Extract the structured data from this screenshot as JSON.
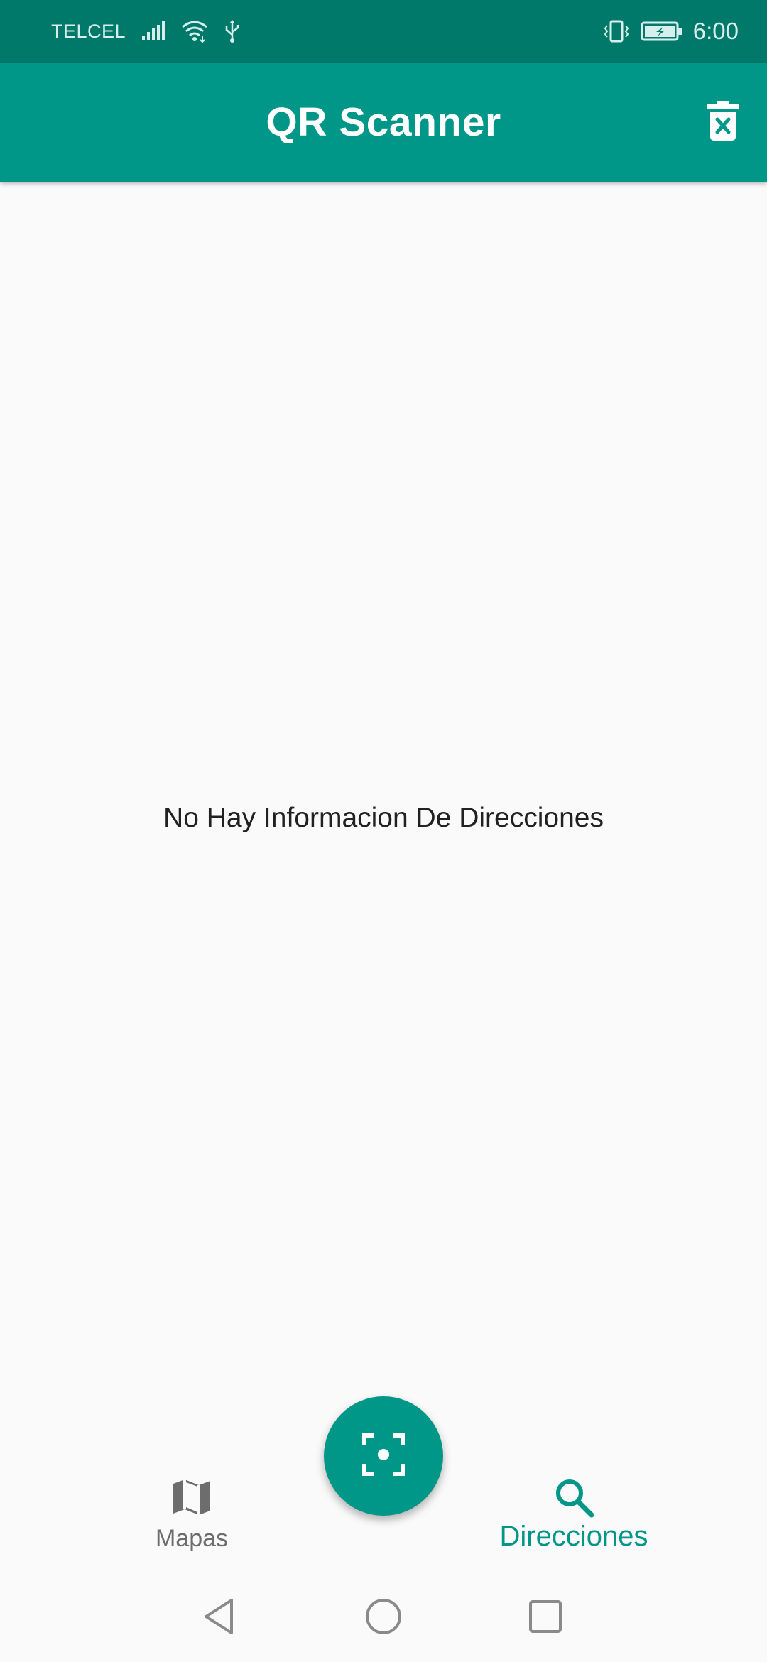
{
  "status_bar": {
    "carrier": "TELCEL",
    "time": "6:00",
    "icons": [
      "signal-icon",
      "wifi-icon",
      "usb-icon",
      "vibrate-icon",
      "battery-charging-icon"
    ]
  },
  "app_bar": {
    "title": "QR Scanner",
    "action_icon": "delete-forever-icon"
  },
  "main": {
    "empty_message": "No Hay Informacion De Direcciones"
  },
  "fab": {
    "icon": "center-focus-icon"
  },
  "bottom_nav": {
    "items": [
      {
        "label": "Mapas",
        "icon": "map-icon",
        "selected": false
      },
      {
        "label": "Direcciones",
        "icon": "search-icon",
        "selected": true
      }
    ]
  },
  "system_nav": {
    "buttons": [
      "back-icon",
      "home-icon",
      "recents-icon"
    ]
  },
  "colors": {
    "primary": "#009688",
    "primary_dark": "#00796b",
    "background": "#fafafa",
    "unselected": "#6d6d6d"
  }
}
